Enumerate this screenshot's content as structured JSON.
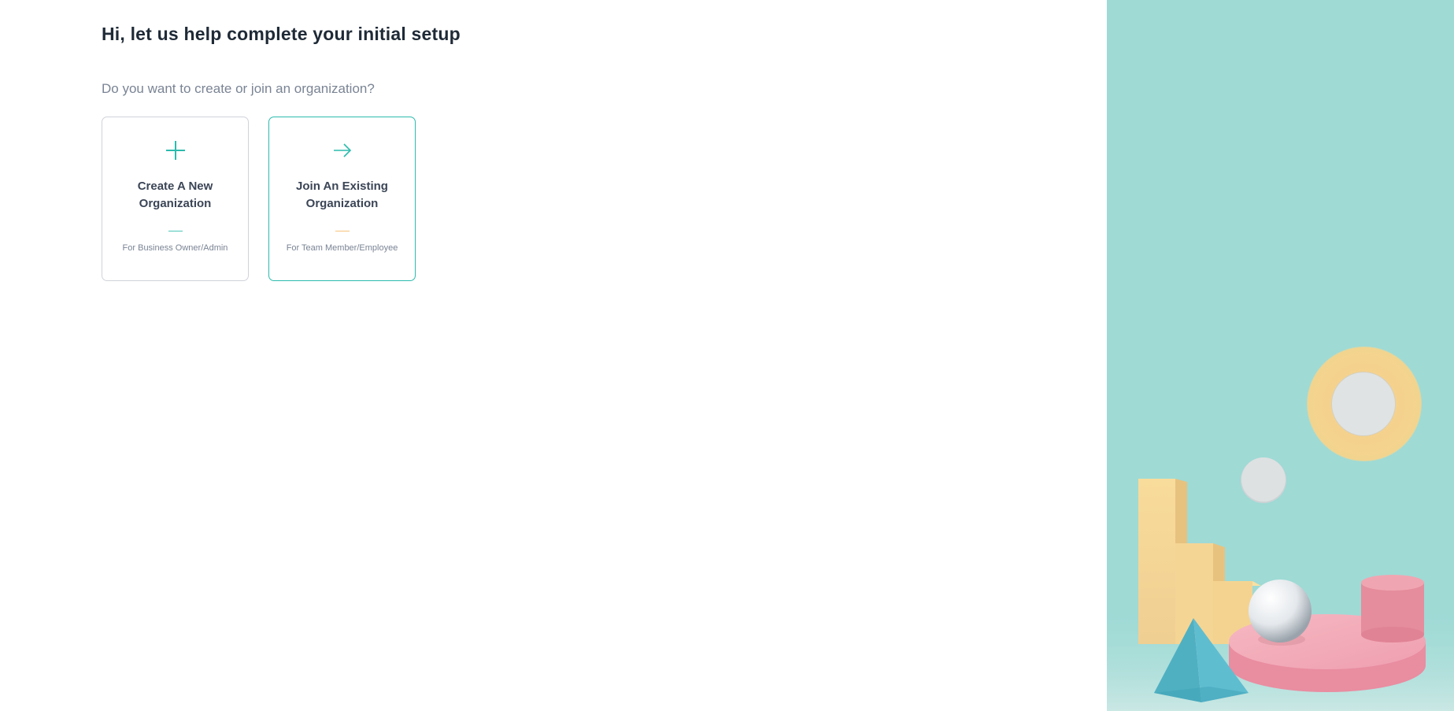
{
  "header": {
    "title": "Hi, let us help complete your initial setup"
  },
  "main": {
    "question": "Do you want to create or join an organization?",
    "options": [
      {
        "label_line1": "Create A New",
        "label_line2": "Organization",
        "subtitle": "For Business Owner/Admin",
        "icon": "plus-icon"
      },
      {
        "label_line1": "Join An Existing",
        "label_line2": "Organization",
        "subtitle": "For Team Member/Employee",
        "icon": "arrow-right-icon"
      }
    ]
  },
  "colors": {
    "accent": "#2bbbad",
    "join_dash": "#f5c37a",
    "panel_bg": "#9fdad5"
  }
}
